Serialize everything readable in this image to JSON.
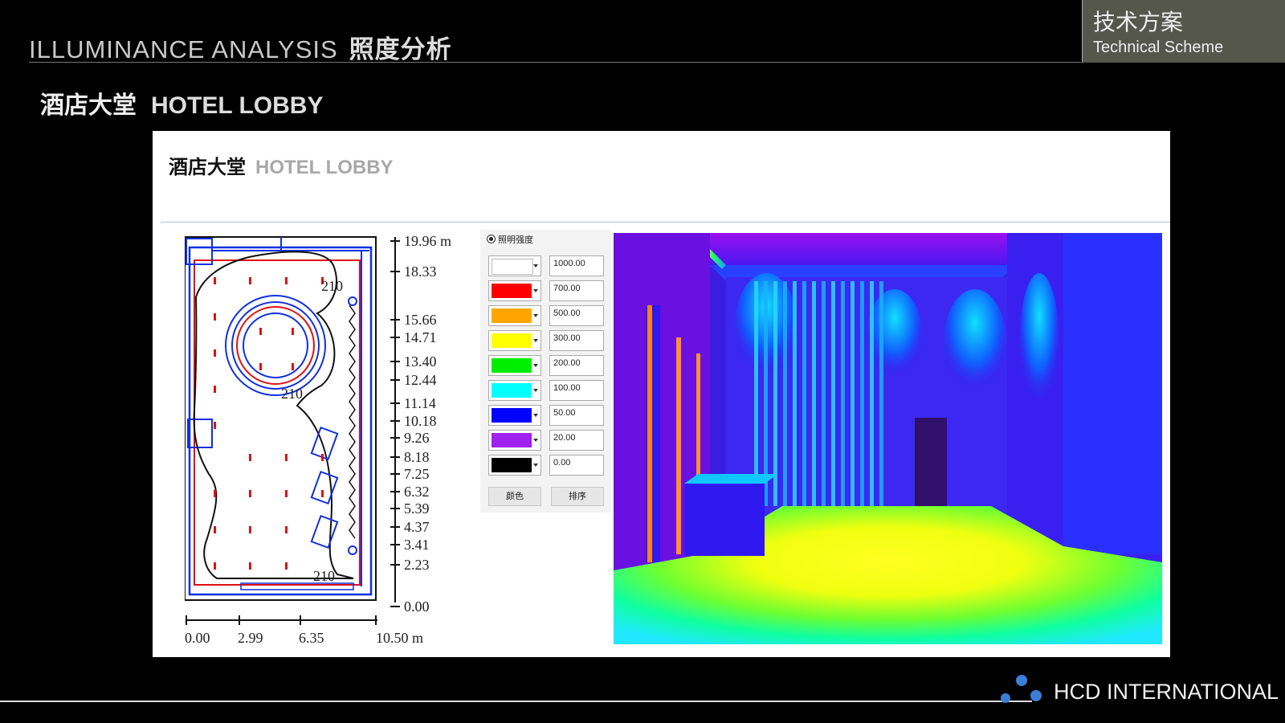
{
  "header": {
    "title_en": "ILLUMINANCE  ANALYSIS",
    "title_cn": "照度分析",
    "scheme_cn": "技术方案",
    "scheme_en": "Technical Scheme"
  },
  "section": {
    "title_cn": "酒店大堂",
    "title_en": "HOTEL LOBBY"
  },
  "panel": {
    "title_cn": "酒店大堂",
    "title_en": "HOTEL LOBBY",
    "plan": {
      "contour_labels": [
        "210",
        "210",
        "210"
      ],
      "y_scale": [
        "19.96 m",
        "18.33",
        "15.66",
        "14.71",
        "13.40",
        "12.44",
        "11.14",
        "10.18",
        "9.26",
        "8.18",
        "7.25",
        "6.32",
        "5.39",
        "4.37",
        "3.41",
        "2.23",
        "0.00"
      ],
      "x_scale": [
        "0.00",
        "2.99",
        "6.35",
        "10.50 m"
      ]
    },
    "legend": {
      "heading": "照明强度",
      "rows": [
        {
          "color": "#ffffff",
          "value": "1000.00"
        },
        {
          "color": "#ff0000",
          "value": "700.00"
        },
        {
          "color": "#ffa500",
          "value": "500.00"
        },
        {
          "color": "#ffff00",
          "value": "300.00"
        },
        {
          "color": "#00ee00",
          "value": "200.00"
        },
        {
          "color": "#00ffff",
          "value": "100.00"
        },
        {
          "color": "#0000ff",
          "value": "50.00"
        },
        {
          "color": "#a020f0",
          "value": "20.00"
        },
        {
          "color": "#000000",
          "value": "0.00"
        }
      ],
      "color_button": "颜色",
      "sort_button": "排序"
    }
  },
  "footer": {
    "brand": "HCD INTERNATIONAL"
  }
}
